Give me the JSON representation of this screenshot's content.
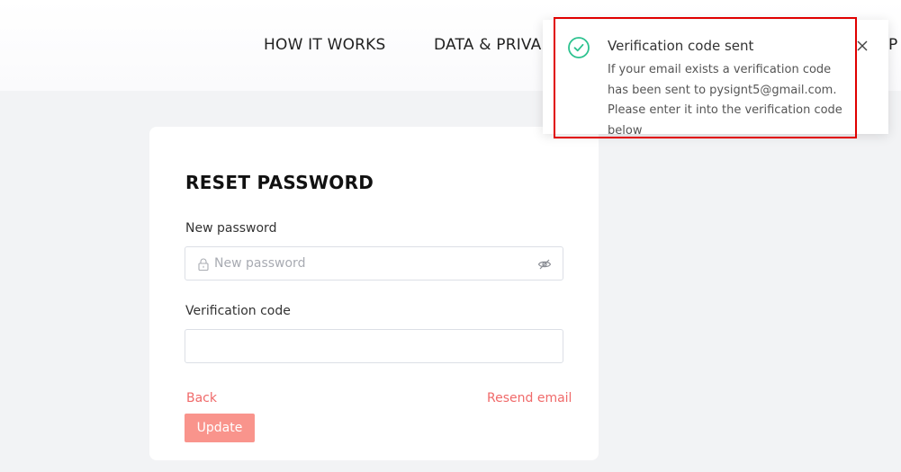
{
  "nav": {
    "items": [
      {
        "label": "HOW IT WORKS"
      },
      {
        "label": "DATA & PRIVA"
      }
    ],
    "overflow_label": "P"
  },
  "reset_form": {
    "title": "RESET PASSWORD",
    "new_password": {
      "label": "New password",
      "placeholder": "New password",
      "value": ""
    },
    "verification_code": {
      "label": "Verification code",
      "placeholder": "",
      "value": ""
    },
    "back_label": "Back",
    "resend_label": "Resend email",
    "update_label": "Update"
  },
  "toast": {
    "title": "Verification code sent",
    "body": "If your email exists a verification code has been sent to pysignt5@gmail.com. Please enter it into the verification code below",
    "status_icon": "check-circle-icon",
    "close_icon": "close-icon"
  },
  "colors": {
    "accent": "#f06a6a",
    "button": "#f9948c",
    "success": "#2cc28f",
    "highlight": "#e00000",
    "background": "#f2f3f5"
  }
}
